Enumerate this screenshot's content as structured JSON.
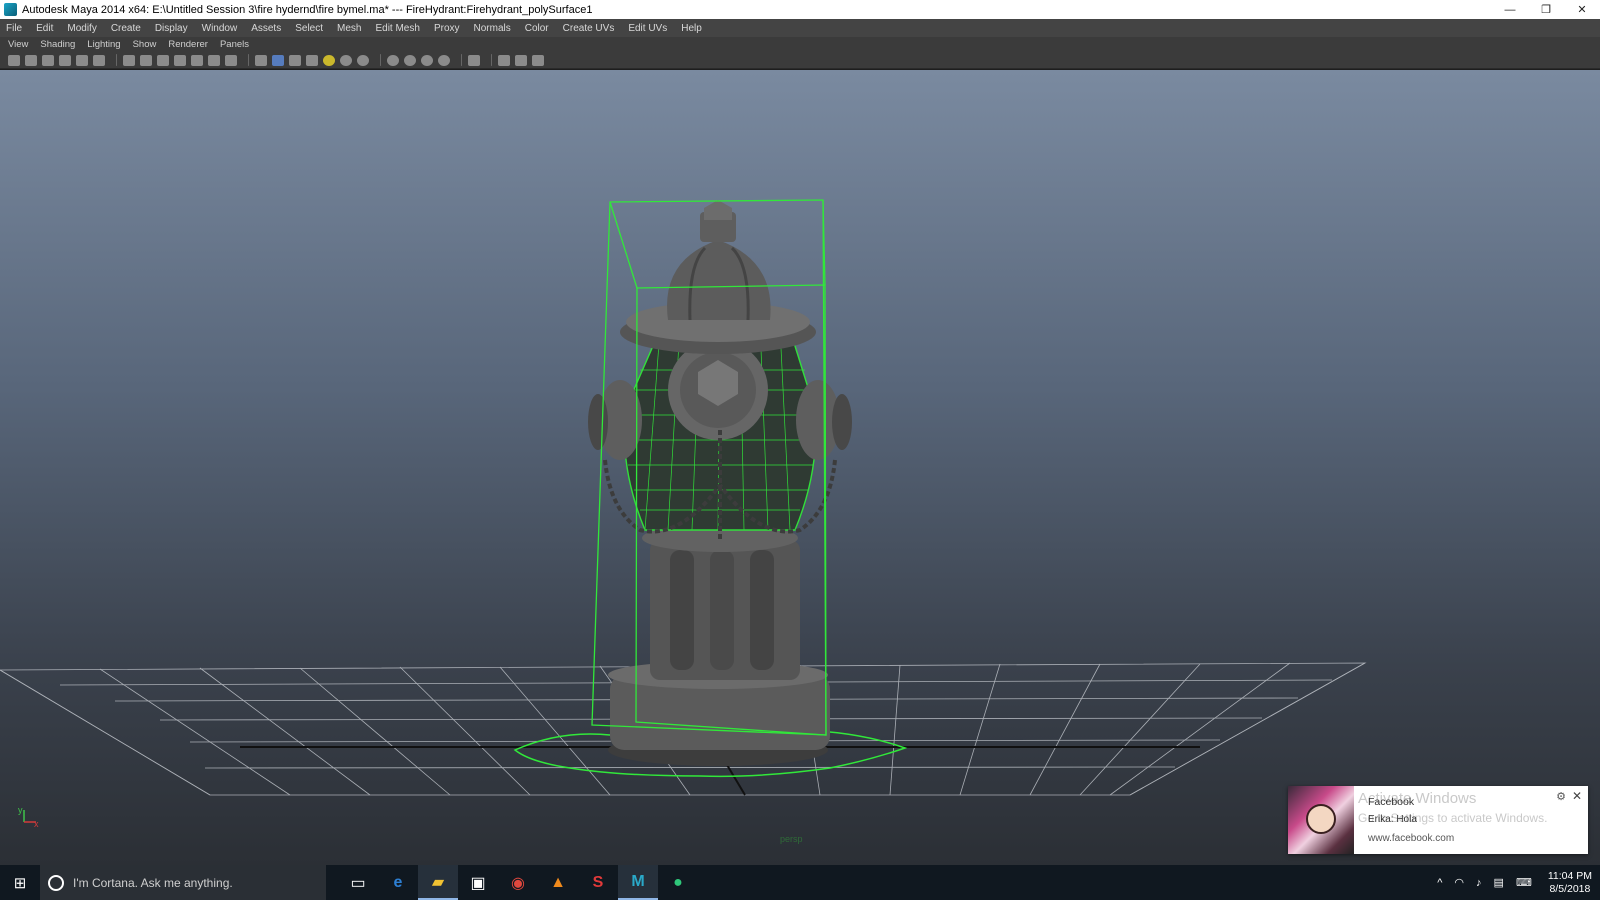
{
  "window": {
    "title": "Autodesk Maya 2014 x64: E:\\Untitled Session 3\\fire hydernd\\fire bymel.ma*   ---   FireHydrant:Firehydrant_polySurface1",
    "controls": [
      "—",
      "❐",
      "✕"
    ]
  },
  "menubar": {
    "items": [
      "File",
      "Edit",
      "Modify",
      "Create",
      "Display",
      "Window",
      "Assets",
      "Select",
      "Mesh",
      "Edit Mesh",
      "Proxy",
      "Normals",
      "Color",
      "Create UVs",
      "Edit UVs",
      "Help"
    ]
  },
  "panel_menu": {
    "items": [
      "View",
      "Shading",
      "Lighting",
      "Show",
      "Renderer",
      "Panels"
    ]
  },
  "viewport": {
    "camera_label": "persp",
    "axis_y": "y",
    "axis_x": "x",
    "selection_color": "#31e83a",
    "background_top": "#7a8aa0"
  },
  "notification": {
    "ghost_title": "Activate Windows",
    "ghost_sub": "Go to Settings to activate Windows.",
    "source": "Facebook",
    "message": "Erika: Hola",
    "url": "www.facebook.com",
    "settings_icon": "gear-icon",
    "close_icon": "close-icon"
  },
  "taskbar": {
    "cortana_placeholder": "I'm Cortana. Ask me anything.",
    "apps": [
      {
        "name": "task-view-icon",
        "glyph": "▭"
      },
      {
        "name": "edge-icon",
        "glyph": "e"
      },
      {
        "name": "file-explorer-icon",
        "glyph": "▰"
      },
      {
        "name": "store-icon",
        "glyph": "▣"
      },
      {
        "name": "chrome-icon",
        "glyph": "◉"
      },
      {
        "name": "vlc-icon",
        "glyph": "▲"
      },
      {
        "name": "app-s-icon",
        "glyph": "S"
      },
      {
        "name": "maya-icon",
        "glyph": "M"
      },
      {
        "name": "chat-icon",
        "glyph": "●"
      }
    ],
    "time": "11:04 PM",
    "date": "8/5/2018"
  }
}
